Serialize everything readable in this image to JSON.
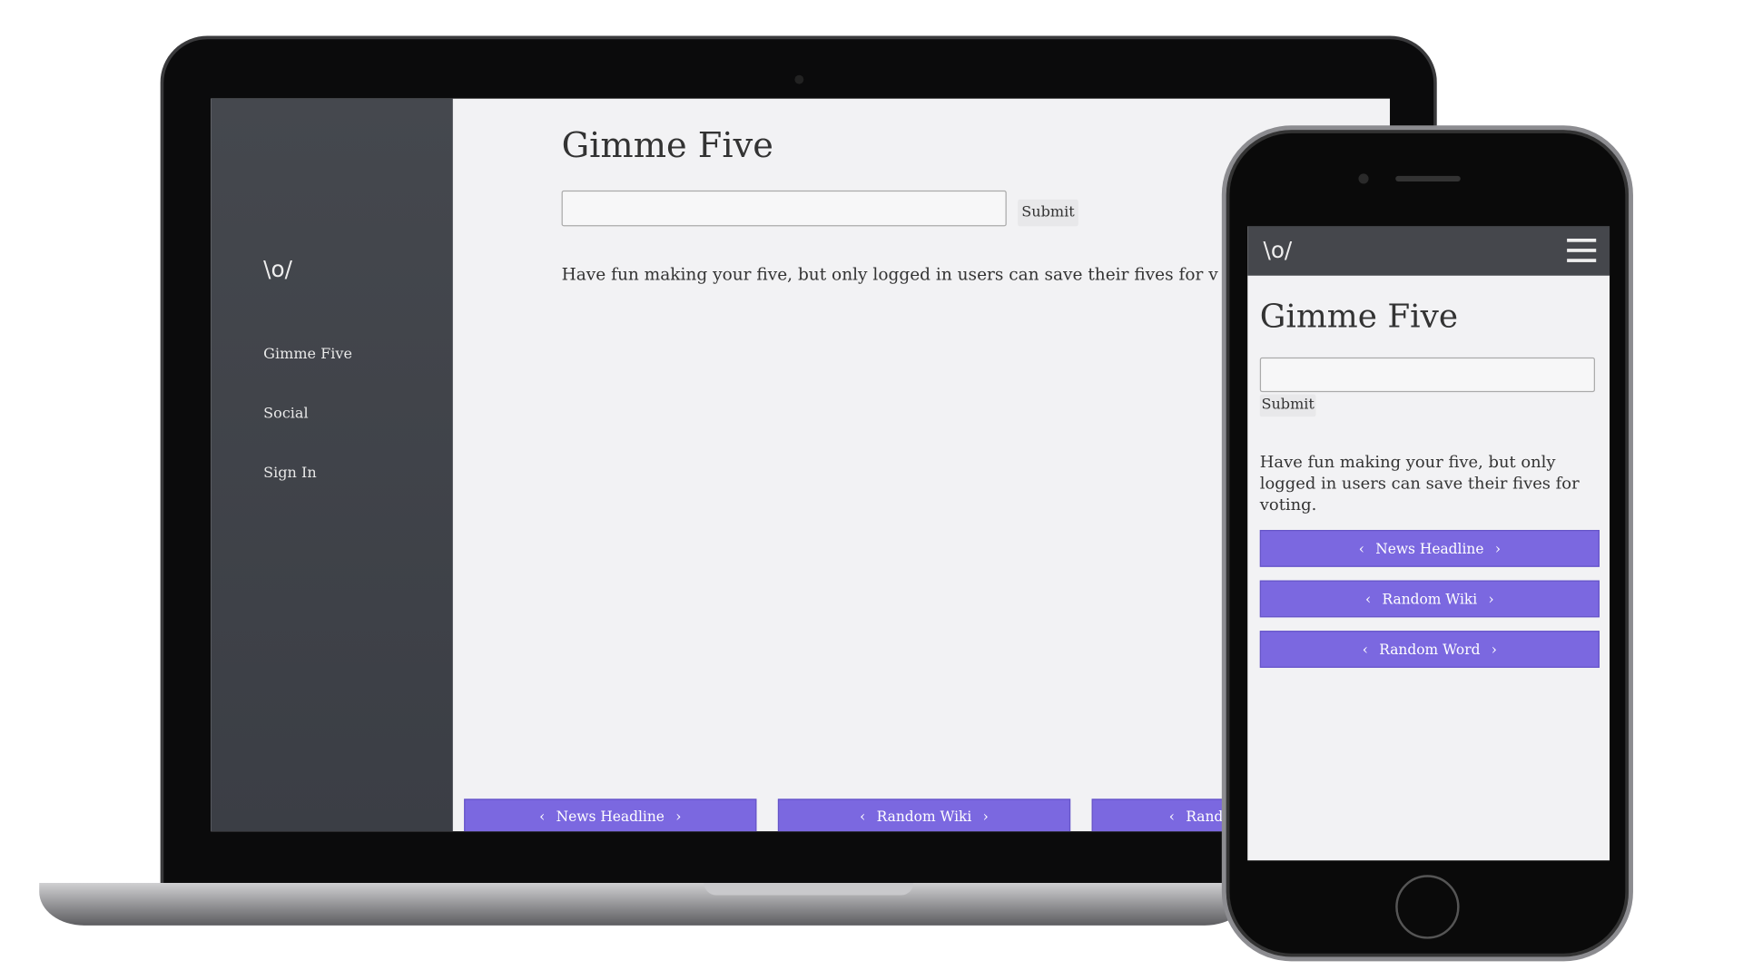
{
  "app": {
    "logo": "\\o/",
    "title": "Gimme Five"
  },
  "sidebar": {
    "items": [
      {
        "label": "Gimme Five"
      },
      {
        "label": "Social"
      },
      {
        "label": "Sign In"
      }
    ]
  },
  "form": {
    "input_value": "",
    "submit_label": "Submit"
  },
  "intro": "Have fun making your five, but only logged in users can save their fives for voting.",
  "laptop_intro_visible": "Have fun making your five, but only logged in users can save their fives for v",
  "buttons": [
    {
      "label": "News Headline"
    },
    {
      "label": "Random Wiki"
    },
    {
      "label": "Random Word"
    }
  ],
  "laptop_third_button_visible": "Rand",
  "icons": {
    "prev": "‹",
    "next": "›",
    "menu": "hamburger-icon"
  },
  "colors": {
    "accent": "#7b68e0",
    "sidebar": "#3d4047",
    "background": "#f2f2f4"
  }
}
